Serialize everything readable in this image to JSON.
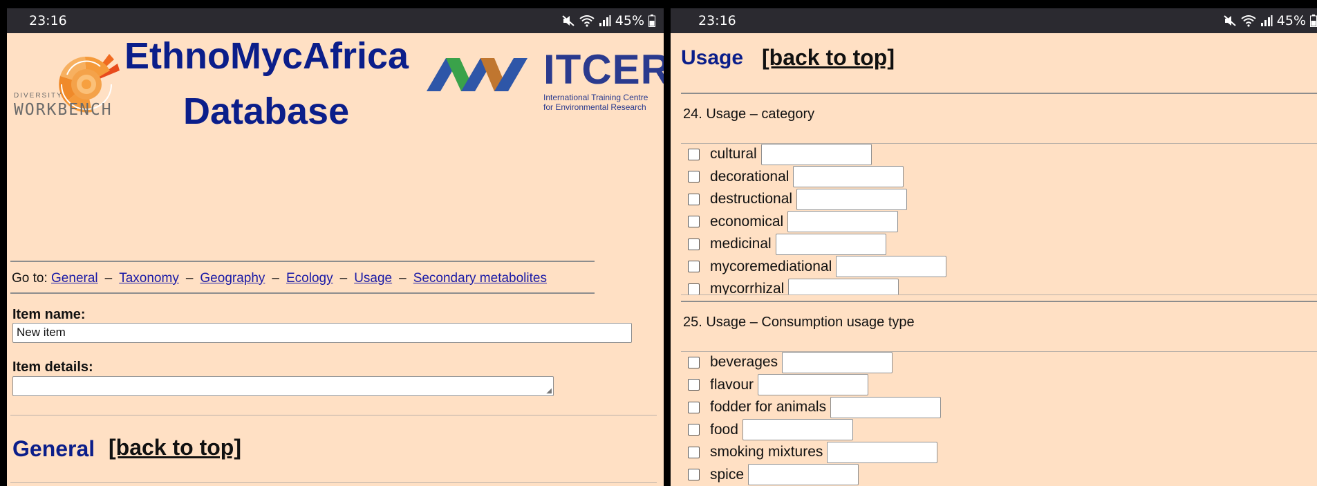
{
  "status": {
    "time": "23:16",
    "battery": "45%"
  },
  "left": {
    "logo_diversity": "DIVERSITY",
    "logo_workbench": "WORKBENCH",
    "title_line1": "EthnoMycAfrica",
    "title_line2": "Database",
    "itcer": "ITCER",
    "itcer_sub1": "International Training Centre",
    "itcer_sub2": "for Environmental Research",
    "goto_prefix": "Go to:",
    "goto_sep": "–",
    "goto_links": [
      "General",
      "Taxonomy",
      "Geography",
      "Ecology",
      "Usage",
      "Secondary metabolites"
    ],
    "item_name_label": "Item name:",
    "item_name_value": "New item",
    "item_details_label": "Item details:",
    "item_details_value": "",
    "section_general": "General",
    "back_to_top": "[back to top]"
  },
  "right": {
    "section_usage": "Usage",
    "back_to_top": "[back to top]",
    "q24_title": "24. Usage – category",
    "q24_options": [
      "cultural",
      "decorational",
      "destructional",
      "economical",
      "medicinal",
      "mycoremediational",
      "mycorrhizal"
    ],
    "q25_title": "25. Usage – Consumption usage type",
    "q25_options": [
      "beverages",
      "flavour",
      "fodder for animals",
      "food",
      "smoking mixtures",
      "spice"
    ]
  },
  "colors": {
    "page_bg": "#ffe0c4",
    "title_blue": "#0b1e8a",
    "link_blue": "#1a1aa6",
    "statusbar": "#2b2a30"
  }
}
